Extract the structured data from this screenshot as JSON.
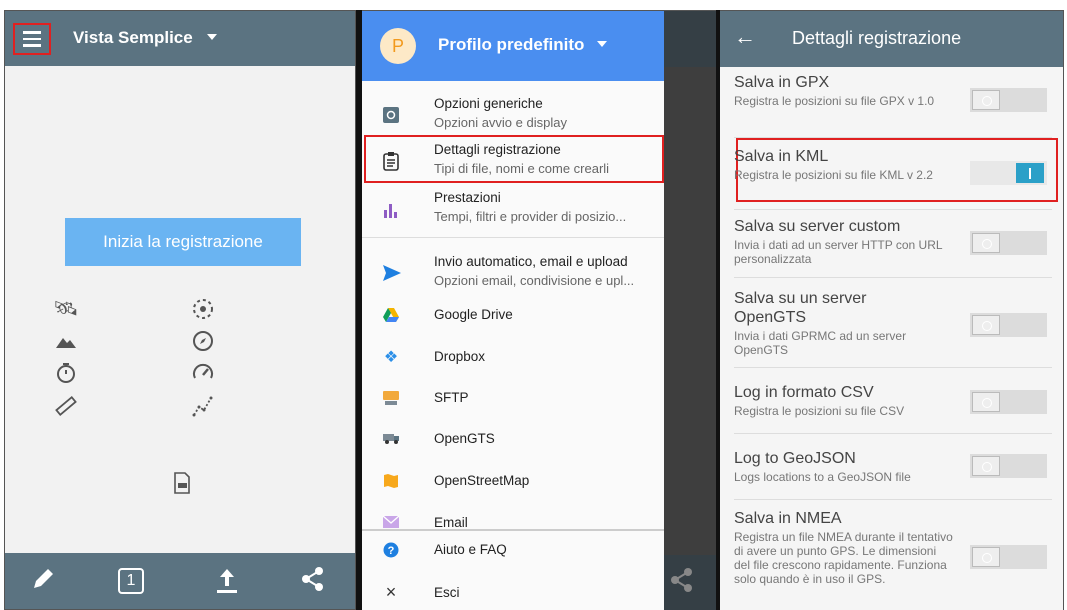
{
  "panel1": {
    "title": "Vista Semplice",
    "start_button": "Inizia la registrazione",
    "icons": [
      "satellite-icon",
      "gps-target-icon",
      "mountain-icon",
      "compass-icon",
      "stopwatch-icon",
      "speedometer-icon",
      "ruler-icon",
      "route-icon",
      "file-icon"
    ],
    "bottom": [
      "pencil-icon",
      "counter-icon",
      "upload-icon",
      "share-icon"
    ],
    "counter_value": "1"
  },
  "drawer": {
    "avatar_letter": "P",
    "profile": "Profilo predefinito",
    "items": [
      {
        "title": "Opzioni generiche",
        "subtitle": "Opzioni avvio e display"
      },
      {
        "title": "Dettagli registrazione",
        "subtitle": "Tipi di file, nomi e come crearli"
      },
      {
        "title": "Prestazioni",
        "subtitle": "Tempi, filtri e provider di posizio..."
      },
      {
        "title": "Invio automatico, email e upload",
        "subtitle": "Opzioni email, condivisione e upl..."
      },
      {
        "title": "Google Drive"
      },
      {
        "title": "Dropbox"
      },
      {
        "title": "SFTP"
      },
      {
        "title": "OpenGTS"
      },
      {
        "title": "OpenStreetMap"
      },
      {
        "title": "Email"
      },
      {
        "title": "Aiuto e FAQ"
      },
      {
        "title": "Esci"
      }
    ]
  },
  "panel3": {
    "title": "Dettagli registrazione",
    "settings": [
      {
        "title": "Salva in GPX",
        "desc": "Registra le posizioni su file GPX v 1.0",
        "on": false
      },
      {
        "title": "Salva in KML",
        "desc": "Registra le posizioni su file KML v 2.2",
        "on": true
      },
      {
        "title": "Salva su server custom",
        "desc": "Invia i dati ad un server HTTP con URL personalizzata",
        "on": false
      },
      {
        "title": "Salva su un server OpenGTS",
        "desc": "Invia i dati GPRMC ad un server OpenGTS",
        "on": false
      },
      {
        "title": "Log in formato CSV",
        "desc": "Registra le posizioni su file CSV",
        "on": false
      },
      {
        "title": "Log to GeoJSON",
        "desc": "Logs locations to a GeoJSON file",
        "on": false
      },
      {
        "title": "Salva in NMEA",
        "desc": "Registra un file NMEA durante il tentativo di avere un punto GPS. Le dimensioni del file crescono rapidamente. Funziona solo quando è in uso il GPS.",
        "on": false
      }
    ]
  },
  "colors": {
    "appbar": "#5b7381",
    "accent_blue": "#4a8ef0",
    "start_button": "#6ab4f2",
    "highlight": "#e02020",
    "toggle_on": "#2ba0c8"
  }
}
